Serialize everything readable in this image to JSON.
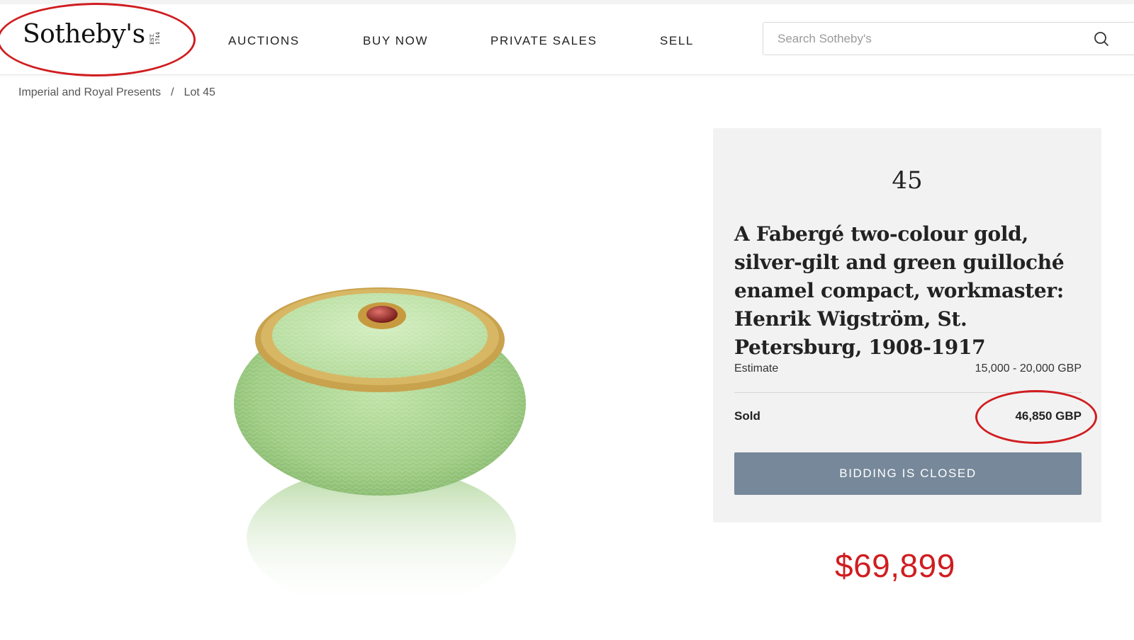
{
  "header": {
    "logo_text": "Sotheby's",
    "logo_est": "EST. 1744",
    "nav": [
      {
        "label": "AUCTIONS"
      },
      {
        "label": "BUY NOW"
      },
      {
        "label": "PRIVATE SALES"
      },
      {
        "label": "SELL"
      }
    ],
    "search": {
      "placeholder": "Search Sotheby's",
      "value": ""
    }
  },
  "breadcrumb": {
    "items": [
      {
        "label": "Imperial and Royal Presents"
      },
      {
        "label": "Lot 45"
      }
    ],
    "separator": "/"
  },
  "lot": {
    "number": "45",
    "title": "A Fabergé two-colour gold, silver-gilt and green guilloché enamel compact, workmaster: Henrik Wigström, St. Petersburg, 1908-1917",
    "estimate_label": "Estimate",
    "estimate_value": "15,000 - 20,000 GBP",
    "sold_label": "Sold",
    "sold_value": "46,850 GBP",
    "button_label": "BIDDING IS CLOSED"
  },
  "annotation": {
    "usd_value": "$69,899"
  },
  "colors": {
    "accent_red": "#d01d20",
    "button_grey": "#76889a",
    "panel_bg": "#f2f2f2",
    "enamel_green": "#a8d48e",
    "gold": "#c9a24e"
  },
  "icons": {
    "search": "search-icon"
  }
}
